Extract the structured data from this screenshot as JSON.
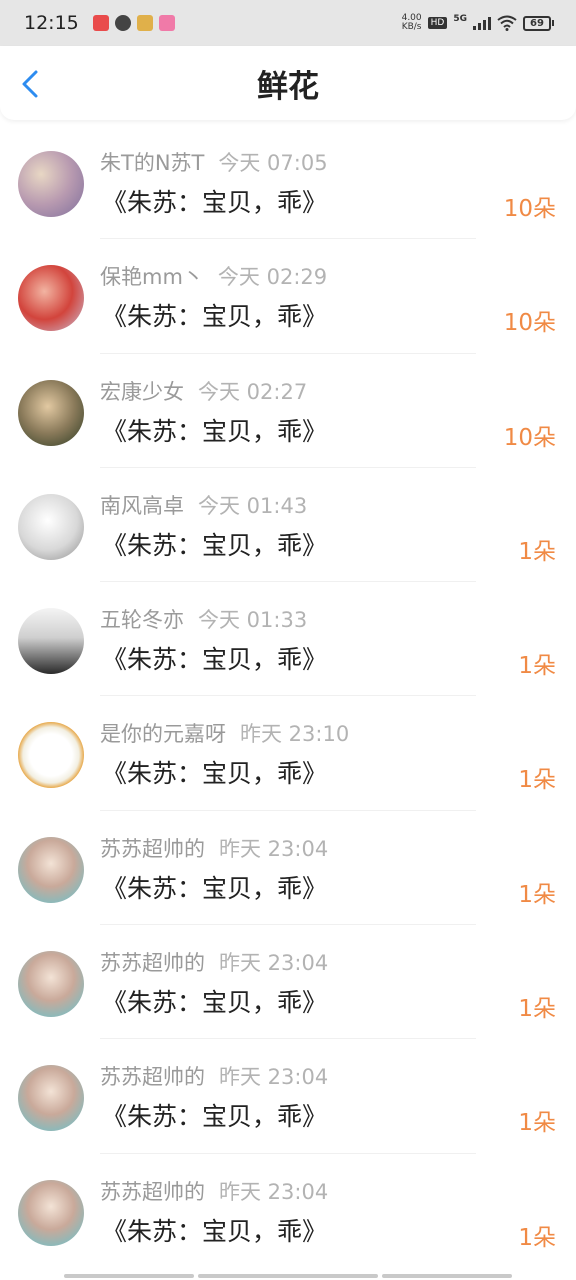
{
  "status_bar": {
    "time": "12:15",
    "speed_value": "4.00",
    "speed_unit": "KB/s",
    "hd": "HD",
    "network": "5G",
    "battery": "69"
  },
  "header": {
    "title": "鲜花"
  },
  "items": [
    {
      "user": "朱T的N苏T",
      "time": "今天 07:05",
      "message": "《朱苏：宝贝，乖》",
      "count": "10朵"
    },
    {
      "user": "保艳mm丶",
      "time": "今天 02:29",
      "message": "《朱苏：宝贝，乖》",
      "count": "10朵"
    },
    {
      "user": "宏康少女",
      "time": "今天 02:27",
      "message": "《朱苏：宝贝，乖》",
      "count": "10朵"
    },
    {
      "user": "南风高卓",
      "time": "今天 01:43",
      "message": "《朱苏：宝贝，乖》",
      "count": "1朵"
    },
    {
      "user": "五轮冬亦",
      "time": "今天 01:33",
      "message": "《朱苏：宝贝，乖》",
      "count": "1朵"
    },
    {
      "user": "是你的元嘉呀",
      "time": "昨天 23:10",
      "message": "《朱苏：宝贝，乖》",
      "count": "1朵"
    },
    {
      "user": "苏苏超帅的",
      "time": "昨天 23:04",
      "message": "《朱苏：宝贝，乖》",
      "count": "1朵"
    },
    {
      "user": "苏苏超帅的",
      "time": "昨天 23:04",
      "message": "《朱苏：宝贝，乖》",
      "count": "1朵"
    },
    {
      "user": "苏苏超帅的",
      "time": "昨天 23:04",
      "message": "《朱苏：宝贝，乖》",
      "count": "1朵"
    },
    {
      "user": "苏苏超帅的",
      "time": "昨天 23:04",
      "message": "《朱苏：宝贝，乖》",
      "count": "1朵"
    }
  ],
  "colors": {
    "accent": "#f08a45",
    "back_arrow": "#2d8cf0"
  }
}
